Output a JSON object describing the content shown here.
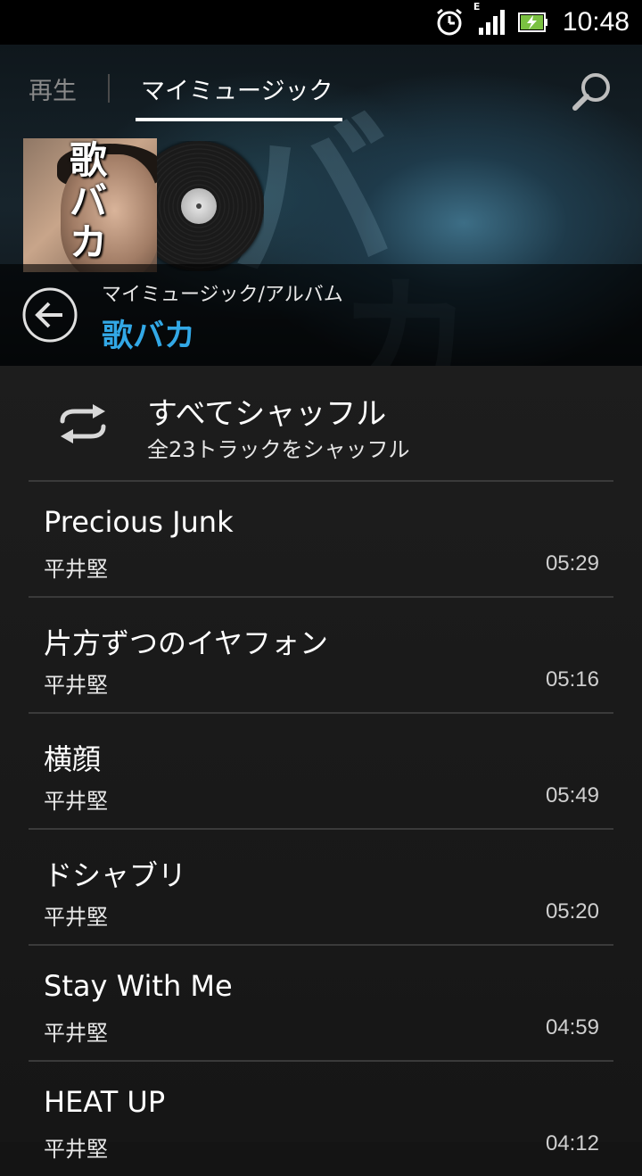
{
  "status_bar": {
    "time": "10:48",
    "network_type": "E",
    "icons": [
      "alarm-icon",
      "signal-icon",
      "battery-charging-icon"
    ]
  },
  "tabs": {
    "play_label": "再生",
    "music_label": "マイミュージック",
    "active": "マイミュージック"
  },
  "album": {
    "art_text": "歌バカ",
    "breadcrumb": "マイミュージック/アルバム",
    "title": "歌バカ"
  },
  "shuffle": {
    "title": "すべてシャッフル",
    "subtitle": "全23トラックをシャッフル"
  },
  "tracks": [
    {
      "title": "Precious Junk",
      "artist": "平井堅",
      "duration": "05:29"
    },
    {
      "title": "片方ずつのイヤフォン",
      "artist": "平井堅",
      "duration": "05:16"
    },
    {
      "title": "横顔",
      "artist": "平井堅",
      "duration": "05:49"
    },
    {
      "title": "ドシャブリ",
      "artist": "平井堅",
      "duration": "05:20"
    },
    {
      "title": "Stay With Me",
      "artist": "平井堅",
      "duration": "04:59"
    },
    {
      "title": "HEAT UP",
      "artist": "平井堅",
      "duration": "04:12"
    }
  ],
  "colors": {
    "accent": "#32a8e6",
    "background": "#141414",
    "divider": "#3a3a3a"
  }
}
